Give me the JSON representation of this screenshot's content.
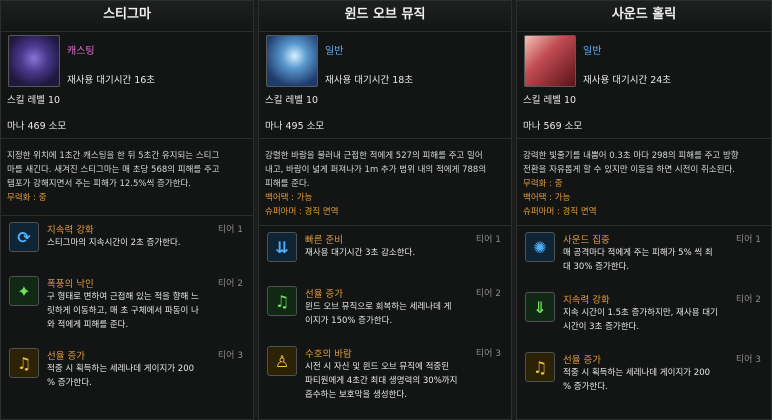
{
  "panels": [
    {
      "title": "스티그마",
      "type": "캐스팅",
      "cooldown": "재사용 대기시간 16초",
      "level": "스킬 레벨 10",
      "mana": "마나 469 소모",
      "desc_lines": [
        "지정한 위치에 1초간 캐스팅을 한 뒤 5초간 유지되는 스티그",
        "마를 새긴다. 새겨진 스티그마는 매 초당 568의 피해를 주고",
        "템포가 강해지면서 주는 피해가 12.5%씩 증가한다."
      ],
      "tags": [
        "무력화 : 중"
      ],
      "tripods": [
        {
          "name": "지속력 강화",
          "tier": "티어 1",
          "desc": [
            "스티그마의 지속시간이 2초 증가한다."
          ],
          "icon": "hourglass-arrow-icon",
          "glyph": "⟳",
          "color": "blue"
        },
        {
          "name": "폭풍의 낙인",
          "tier": "티어 2",
          "desc": [
            "구 형태로 변하여 근접해 있는 적을 향해 느",
            "릿하게 이동하고, 매 초 구체에서 파동이 나",
            "와 적에게 피해를 준다."
          ],
          "icon": "storm-brand-icon",
          "glyph": "✦",
          "color": "green"
        },
        {
          "name": "선율 증가",
          "tier": "티어 3",
          "desc": [
            "적중 시 획득하는 세레나데 게이지가 200",
            "% 증가한다."
          ],
          "icon": "music-note-icon",
          "glyph": "♫",
          "color": "gold"
        }
      ]
    },
    {
      "title": "윈드 오브 뮤직",
      "type": "일반",
      "cooldown": "재사용 대기시간 18초",
      "level": "스킬 레벨 10",
      "mana": "마나 495 소모",
      "desc_lines": [
        "강렬한 바람을 불러내 근접한 적에게 527의 피해를 주고 밀어",
        "내고, 바람이 넓게 퍼져나가 1m 추가 범위 내의 적에게 788의",
        "피해를 준다."
      ],
      "tags": [
        "백어택 : 가능",
        "슈퍼아머 : 경직 면역"
      ],
      "tripods": [
        {
          "name": "빠른 준비",
          "tier": "티어 1",
          "desc": [
            "재사용 대기시간 3초 감소한다."
          ],
          "icon": "quick-prep-icon",
          "glyph": "⇊",
          "color": "blue"
        },
        {
          "name": "선율 증가",
          "tier": "티어 2",
          "desc": [
            "윈드 오브 뮤직으로 회복하는 세레나데 게",
            "이지가 150% 증가한다."
          ],
          "icon": "music-note-icon",
          "glyph": "♫",
          "color": "green"
        },
        {
          "name": "수호의 바람",
          "tier": "티어 3",
          "desc": [
            "시전 시 자신 및 윈드 오브 뮤직에 적중된",
            "파티원에게 4초간 최대 생명력의 30%까지",
            "흡수하는 보호막을 생성한다."
          ],
          "icon": "guardian-figure-icon",
          "glyph": "♙",
          "color": "gold"
        }
      ]
    },
    {
      "title": "사운드 홀릭",
      "type": "일반",
      "cooldown": "재사용 대기시간 24초",
      "level": "스킬 레벨 10",
      "mana": "마나 569 소모",
      "desc_lines": [
        "강력한 빛줄기를 내뿜어 0.3초 마다 298의 피해를 주고 방향",
        "전환을 자유롭게 할 수 있지만 이동을 하면 시전이 취소된다."
      ],
      "tags": [
        "무력화 : 중",
        "백어택 : 가능",
        "슈퍼아머 : 경직 면역"
      ],
      "tripods": [
        {
          "name": "사운드 집중",
          "tier": "티어 1",
          "desc": [
            "매 공격마다 적에게 주는 피해가 5% 씩 최",
            "대 30% 증가한다."
          ],
          "icon": "sound-focus-icon",
          "glyph": "✺",
          "color": "blue"
        },
        {
          "name": "지속력 강화",
          "tier": "티어 2",
          "desc": [
            "지속 시간이 1.5초 증가하지만, 재사용 대기",
            "시간이 3초 증가한다."
          ],
          "icon": "download-arrow-icon",
          "glyph": "⇓",
          "color": "green"
        },
        {
          "name": "선율 증가",
          "tier": "티어 3",
          "desc": [
            "적중 시 획득하는 세레나데 게이지가 200",
            "% 증가한다."
          ],
          "icon": "music-note-icon",
          "glyph": "♫",
          "color": "gold"
        }
      ]
    }
  ]
}
